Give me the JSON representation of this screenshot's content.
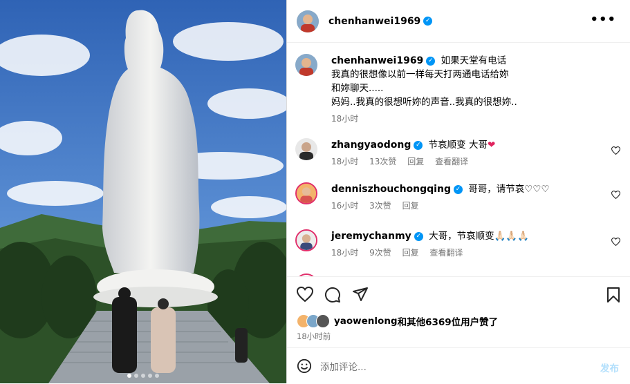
{
  "post": {
    "author": "chenhanwei1969",
    "caption_lines": [
      "如果天堂有电话",
      "我真的很想像以前一样每天打两通电话给妳",
      "和妳聊天.....",
      "妈妈..我真的很想听妳的声音..我真的很想妳.."
    ],
    "caption_time": "18小时"
  },
  "header": {
    "username": "chenhanwei1969",
    "more_icon": "more-horizontal-icon"
  },
  "comments": [
    {
      "user": "zhangyaodong",
      "text": "节哀顺变 大哥",
      "emoji": "❤",
      "time": "18小时",
      "likes": "13次赞",
      "reply": "回复",
      "translate": "查看翻译"
    },
    {
      "user": "denniszhouchongqing",
      "text": "哥哥，请节哀♡♡♡",
      "time": "16小时",
      "likes": "3次赞",
      "reply": "回复"
    },
    {
      "user": "jeremychanmy",
      "text": "大哥，节哀顺变🙏🏻🙏🏻🙏🏻",
      "time": "18小时",
      "likes": "9次赞",
      "reply": "回复",
      "translate": "查看翻译"
    }
  ],
  "liked_by": {
    "user": "yaowenlong",
    "rest": "和其他6369位用户赞了"
  },
  "post_time": "18小时前",
  "add_comment": {
    "placeholder": "添加评论...",
    "post_label": "发布"
  },
  "carousel": {
    "total": 5,
    "active": 0
  },
  "colors": {
    "verified": "#0095f6",
    "heart_red": "#ed4956",
    "muted": "#737373"
  }
}
